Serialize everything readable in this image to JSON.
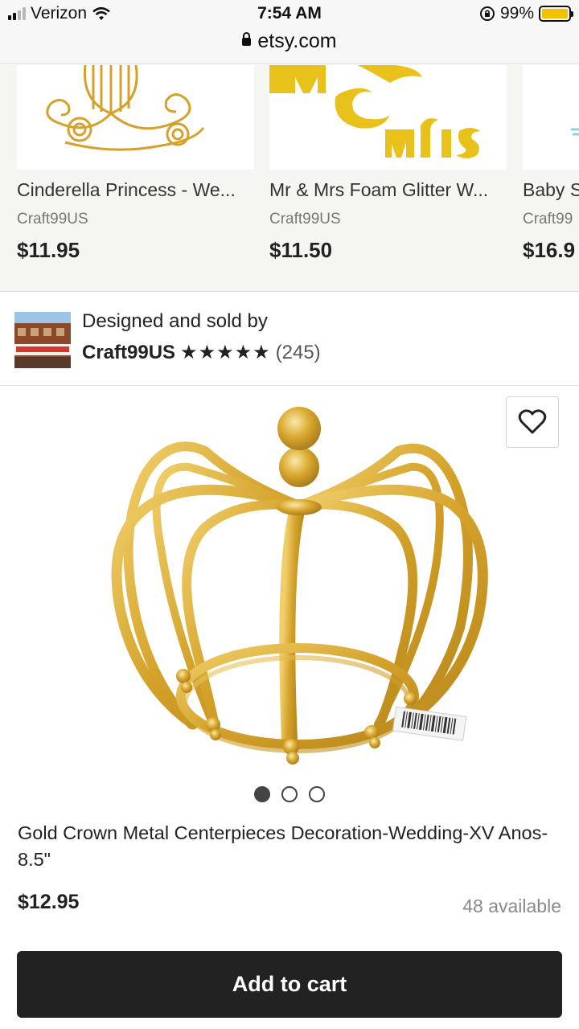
{
  "status_bar": {
    "carrier": "Verizon",
    "time": "7:54 AM",
    "battery_percent": "99%",
    "battery_level": 0.99,
    "url": "etsy.com"
  },
  "related_items": [
    {
      "title": "Cinderella Princess - Wedding Carriage",
      "display_title": "Cinderella Princess - We...",
      "shop": "Craft99US",
      "price": "$11.95"
    },
    {
      "title": "Mr & Mrs Foam Glitter Wedding Sign",
      "display_title": "Mr & Mrs Foam Glitter W...",
      "shop": "Craft99US",
      "price": "$11.50"
    },
    {
      "title": "Baby S",
      "display_title": "Baby S",
      "shop": "Craft99",
      "price": "$16.9"
    }
  ],
  "seller": {
    "heading": "Designed and sold by",
    "name": "Craft99US",
    "stars": "★★★★★",
    "rating": 5,
    "reviews": "(245)"
  },
  "product": {
    "title": "Gold Crown Metal Centerpieces Decoration-Wedding-XV Anos-8.5\"",
    "price": "$12.95",
    "availability": "48 available",
    "image_count": 3,
    "active_image": 1
  },
  "cart_button": {
    "label": "Add to cart"
  },
  "colors": {
    "accent": "#222222",
    "gold": "#d4a22a",
    "battery": "#f2c200"
  },
  "icons": [
    "signal-icon",
    "wifi-icon",
    "rotation-lock-icon",
    "battery-icon",
    "lock-icon",
    "heart-icon"
  ]
}
